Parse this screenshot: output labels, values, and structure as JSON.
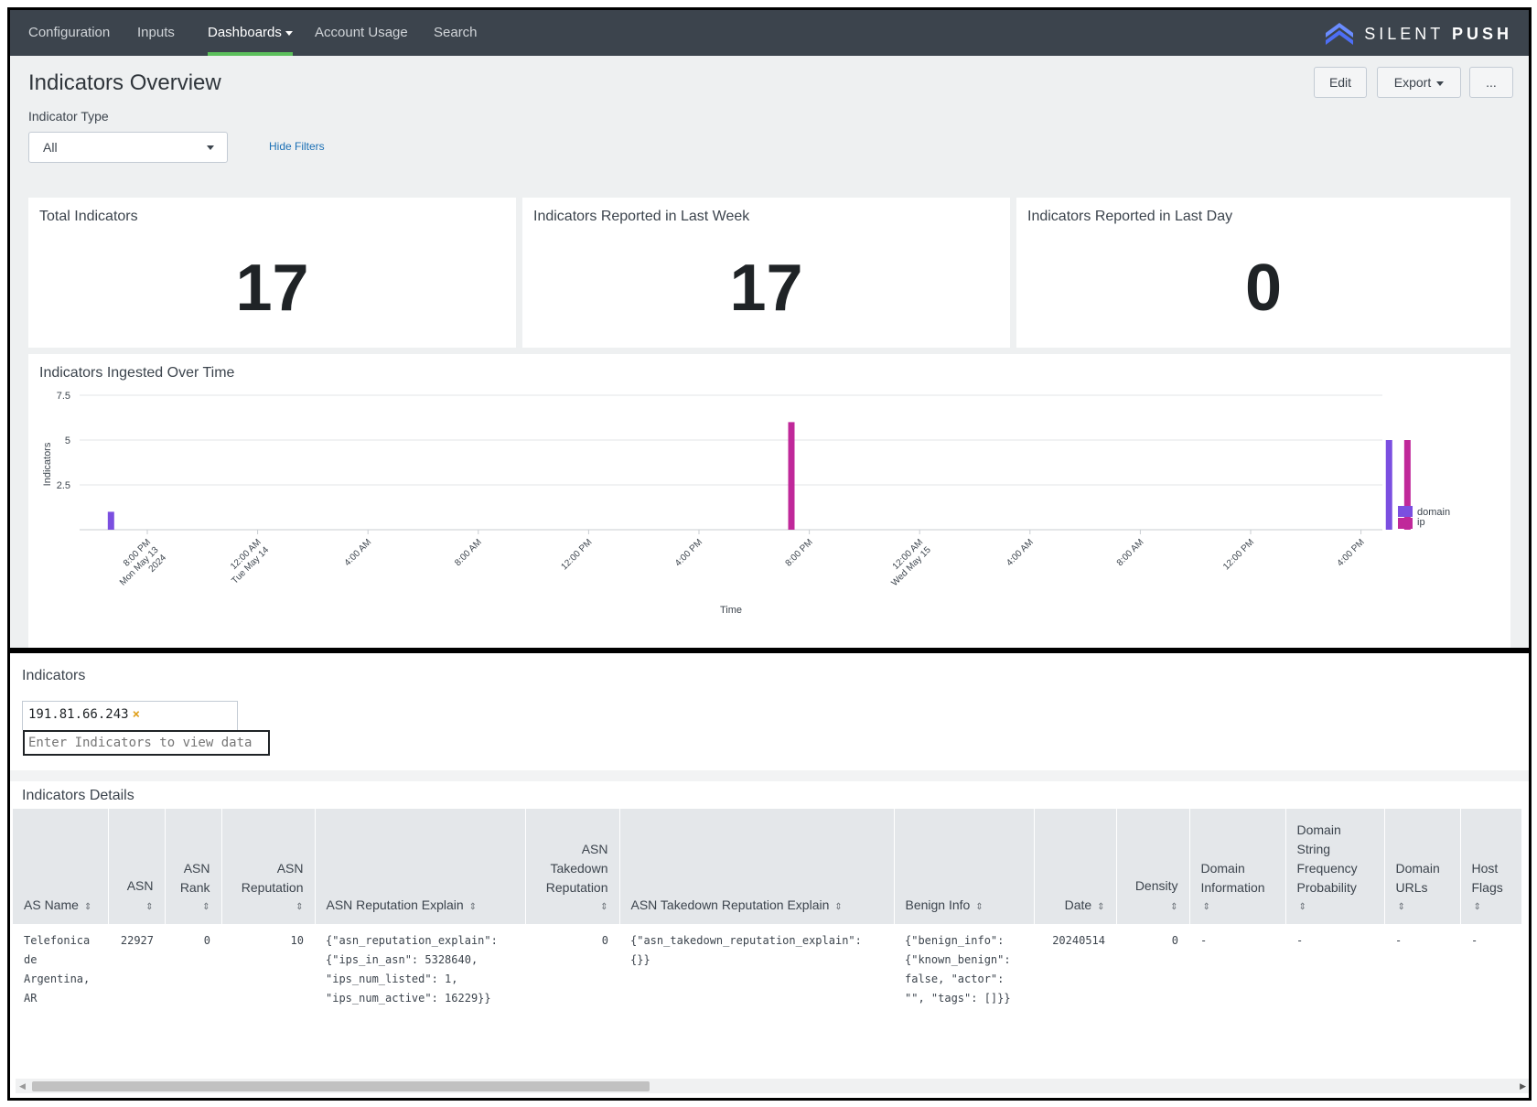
{
  "nav": {
    "items": [
      "Configuration",
      "Inputs",
      "Dashboards",
      "Account Usage",
      "Search"
    ],
    "active": "Dashboards",
    "brand_light": "SILENT",
    "brand_bold": "PUSH",
    "accent": "#5cc05c"
  },
  "header": {
    "title": "Indicators Overview",
    "filter_label": "Indicator Type",
    "filter_value": "All",
    "hide_filters": "Hide Filters",
    "edit": "Edit",
    "export": "Export",
    "more": "..."
  },
  "kpis": [
    {
      "title": "Total Indicators",
      "value": "17"
    },
    {
      "title": "Indicators Reported in Last Week",
      "value": "17"
    },
    {
      "title": "Indicators Reported in Last Day",
      "value": "0"
    }
  ],
  "chart_data": {
    "type": "bar",
    "title": "Indicators Ingested Over Time",
    "xlabel": "Time",
    "ylabel": "Indicators",
    "ylim": [
      0,
      7.5
    ],
    "yticks": [
      "7.5",
      "5",
      "2.5"
    ],
    "x_tick_labels": [
      [
        "8:00 PM",
        "Mon May 13",
        "2024"
      ],
      [
        "12:00 AM",
        "Tue May 14"
      ],
      [
        "4:00 AM"
      ],
      [
        "8:00 AM"
      ],
      [
        "12:00 PM"
      ],
      [
        "4:00 PM"
      ],
      [
        "8:00 PM"
      ],
      [
        "12:00 AM",
        "Wed May 15"
      ],
      [
        "4:00 AM"
      ],
      [
        "8:00 AM"
      ],
      [
        "12:00 PM"
      ],
      [
        "4:00 PM"
      ]
    ],
    "series": [
      {
        "name": "domain",
        "color": "#7b4fe0",
        "points": [
          {
            "x": "2024-05-13 18:40",
            "y": 1
          },
          {
            "x": "2024-05-15 17:00",
            "y": 5
          }
        ]
      },
      {
        "name": "ip",
        "color": "#c0289a",
        "points": [
          {
            "x": "2024-05-14 19:20",
            "y": 6
          },
          {
            "x": "2024-05-15 17:40",
            "y": 5
          }
        ]
      }
    ],
    "legend_position": "right",
    "grid": true
  },
  "bottom": {
    "indicators_title": "Indicators",
    "token": "191.81.66.243",
    "token_remove": "×",
    "input_placeholder": "Enter Indicators to view data",
    "details_title": "Indicators Details"
  },
  "table": {
    "columns": [
      [
        "AS Name"
      ],
      [
        "ASN"
      ],
      [
        "ASN",
        "Rank"
      ],
      [
        "ASN",
        "Reputation"
      ],
      [
        "ASN Reputation Explain"
      ],
      [
        "ASN",
        "Takedown",
        "Reputation"
      ],
      [
        "ASN Takedown Reputation Explain"
      ],
      [
        "Benign Info"
      ],
      [
        "Date"
      ],
      [
        "Density"
      ],
      [
        "Domain",
        "Information"
      ],
      [
        "Domain",
        "String",
        "Frequency",
        "Probability"
      ],
      [
        "Domain",
        "URLs"
      ],
      [
        "Host",
        "Flags"
      ]
    ],
    "row": [
      "Telefonica\nde\nArgentina,\nAR",
      "22927",
      "0",
      "10",
      "{\"asn_reputation_explain\":\n{\"ips_in_asn\": 5328640,\n\"ips_num_listed\": 1,\n\"ips_num_active\": 16229}}",
      "0",
      "{\"asn_takedown_reputation_explain\":\n{}}",
      "{\"benign_info\":\n{\"known_benign\":\nfalse, \"actor\":\n\"\", \"tags\": []}}",
      "20240514",
      "0",
      "-",
      "-",
      "-",
      "-"
    ]
  }
}
